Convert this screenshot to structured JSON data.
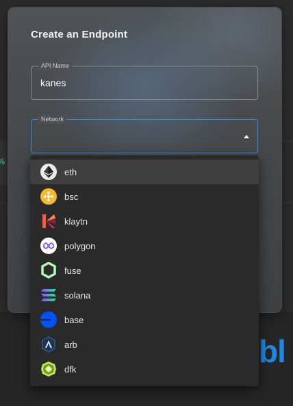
{
  "modal": {
    "title": "Create an Endpoint"
  },
  "api_name_field": {
    "label": "API Name",
    "value": "kanes"
  },
  "network_field": {
    "label": "Network",
    "value": ""
  },
  "network_options": [
    {
      "label": "eth",
      "icon": "ethereum-icon",
      "selected": true
    },
    {
      "label": "bsc",
      "icon": "bnb-icon",
      "selected": false
    },
    {
      "label": "klaytn",
      "icon": "klaytn-icon",
      "selected": false
    },
    {
      "label": "polygon",
      "icon": "polygon-icon",
      "selected": false
    },
    {
      "label": "fuse",
      "icon": "fuse-icon",
      "selected": false
    },
    {
      "label": "solana",
      "icon": "solana-icon",
      "selected": false
    },
    {
      "label": "base",
      "icon": "base-icon",
      "selected": false
    },
    {
      "label": "arb",
      "icon": "arbitrum-icon",
      "selected": false
    },
    {
      "label": "dfk",
      "icon": "dfk-icon",
      "selected": false
    }
  ],
  "background": {
    "percent_fragment": "%",
    "brand_fragment": "bl"
  },
  "colors": {
    "focus_border": "#2f8fe8",
    "dropdown_bg": "#2a2a2a",
    "selected_bg": "#3f3f40"
  }
}
